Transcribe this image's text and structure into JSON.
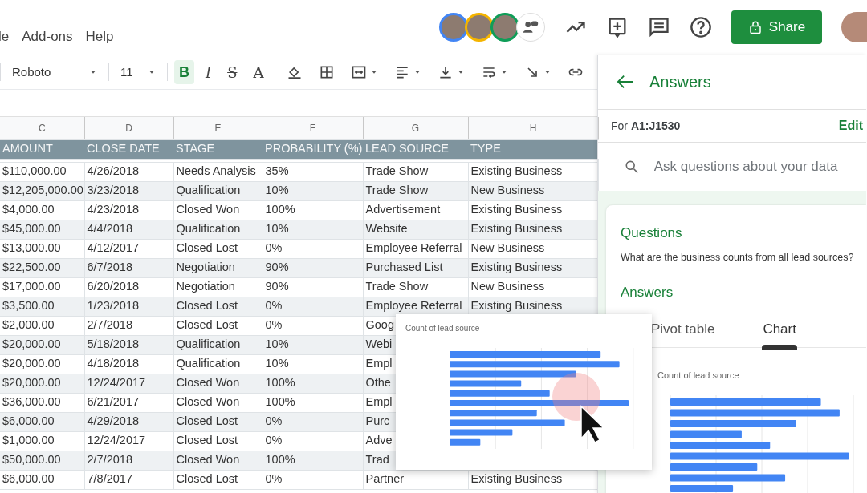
{
  "menu": [
    "le",
    "Add-ons",
    "Help"
  ],
  "collaborators": [
    {
      "color": "#4285f4"
    },
    {
      "color": "#f4b400"
    },
    {
      "color": "#0f9d58"
    }
  ],
  "share_button": "Share",
  "toolbar": {
    "font": "Roboto",
    "font_size": "11",
    "formats": [
      {
        "kind": "bold",
        "label": "B",
        "active": true
      },
      {
        "kind": "italic",
        "label": "I",
        "active": false
      },
      {
        "kind": "strike",
        "label": "S",
        "active": false
      },
      {
        "kind": "color",
        "label": "A",
        "active": false
      }
    ],
    "tools": [
      {
        "kind": "fill"
      },
      {
        "kind": "borders"
      },
      {
        "kind": "merge"
      },
      {
        "kind": "halign"
      },
      {
        "kind": "valign"
      },
      {
        "kind": "wrap"
      },
      {
        "kind": "rotate"
      },
      {
        "kind": "link"
      }
    ]
  },
  "sheet": {
    "columns": [
      "C",
      "D",
      "E",
      "F",
      "G",
      "H"
    ],
    "headers": [
      "AMOUNT",
      "CLOSE DATE",
      "STAGE",
      "PROBABILITY (%)",
      "LEAD SOURCE",
      "TYPE"
    ],
    "rows": [
      [
        "$110,000.00",
        "4/26/2018",
        "Needs Analysis",
        "35%",
        "Trade Show",
        "Existing Business"
      ],
      [
        "$12,205,000.00",
        "3/23/2018",
        "Qualification",
        "10%",
        "Trade Show",
        "New Business"
      ],
      [
        "$4,000.00",
        "4/23/2018",
        "Closed Won",
        "100%",
        "Advertisement",
        "Existing Business"
      ],
      [
        "$45,000.00",
        "4/4/2018",
        "Qualification",
        "10%",
        "Website",
        "Existing Business"
      ],
      [
        "$13,000.00",
        "4/12/2017",
        "Closed Lost",
        "0%",
        "Employee Referral",
        "New Business"
      ],
      [
        "$22,500.00",
        "6/7/2018",
        "Negotiation",
        "90%",
        "Purchased List",
        "Existing Business"
      ],
      [
        "$17,000.00",
        "6/20/2018",
        "Negotiation",
        "90%",
        "Trade Show",
        "New Business"
      ],
      [
        "$3,500.00",
        "1/23/2018",
        "Closed Lost",
        "0%",
        "Employee Referral",
        "Existing Business"
      ],
      [
        "$2,000.00",
        "2/7/2018",
        "Closed Lost",
        "0%",
        "Goog"
      ],
      [
        "$20,000.00",
        "5/18/2018",
        "Qualification",
        "10%",
        "Webi"
      ],
      [
        "$20,000.00",
        "4/18/2018",
        "Qualification",
        "10%",
        "Empl"
      ],
      [
        "$20,000.00",
        "12/24/2017",
        "Closed Won",
        "100%",
        "Othe"
      ],
      [
        "$36,000.00",
        "6/21/2017",
        "Closed Won",
        "100%",
        "Empl"
      ],
      [
        "$6,000.00",
        "4/29/2018",
        "Closed Lost",
        "0%",
        "Purc"
      ],
      [
        "$1,000.00",
        "12/24/2017",
        "Closed Lost",
        "0%",
        "Adve"
      ],
      [
        "$50,000.00",
        "2/7/2018",
        "Closed Won",
        "100%",
        "Trad"
      ],
      [
        "$6,000.00",
        "7/8/2017",
        "Closed Lost",
        "0%",
        "Partner",
        "Existing Business"
      ]
    ]
  },
  "floating_chart": {
    "title": "Count of lead source"
  },
  "panel": {
    "title": "Answers",
    "range": "For **A1:J1530**",
    "edit": "Edit",
    "search": {
      "placeholder": "Ask questions about your data"
    },
    "questions_heading": "Questions",
    "question": "What are the business counts from all lead sources?",
    "answers_heading": "Answers",
    "tabs": [
      {
        "label": "Pivot table",
        "selected": false
      },
      {
        "label": "Chart",
        "selected": true
      }
    ],
    "chart_title": "Count of lead source"
  }
}
